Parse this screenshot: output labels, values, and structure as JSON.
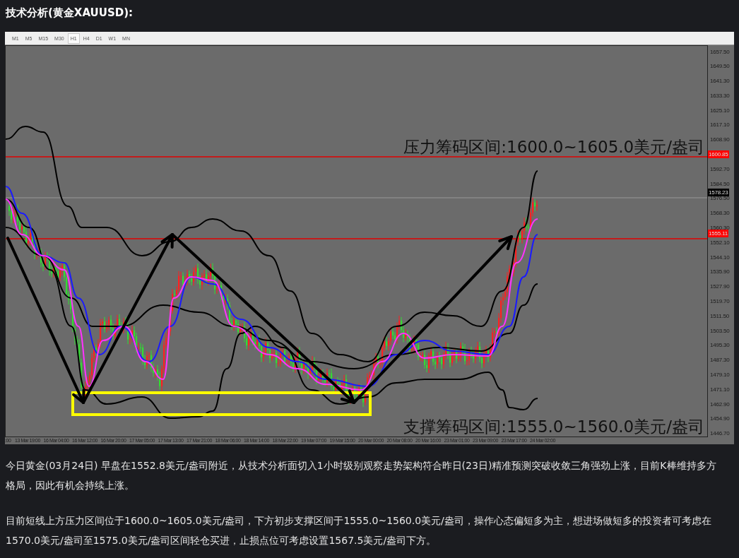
{
  "title": "技术分析(黄金XAUUSD):",
  "chart": {
    "timeframes": [
      {
        "label": "M1",
        "selected": false
      },
      {
        "label": "M5",
        "selected": false
      },
      {
        "label": "M15",
        "selected": false
      },
      {
        "label": "M30",
        "selected": false
      },
      {
        "label": "H1",
        "selected": true
      },
      {
        "label": "H4",
        "selected": false
      },
      {
        "label": "D1",
        "selected": false
      },
      {
        "label": "W1",
        "selected": false
      },
      {
        "label": "MN",
        "selected": false
      }
    ],
    "price_axis": [
      {
        "kind": "tick",
        "label": "1657.50"
      },
      {
        "kind": "tick",
        "label": "1649.50"
      },
      {
        "kind": "tick",
        "label": "1641.30"
      },
      {
        "kind": "tick",
        "label": "1633.30"
      },
      {
        "kind": "tick",
        "label": "1625.10"
      },
      {
        "kind": "tick",
        "label": "1617.10"
      },
      {
        "kind": "tick",
        "label": "1608.90"
      },
      {
        "kind": "level",
        "label": "1600.85"
      },
      {
        "kind": "tick",
        "label": "1592.70"
      },
      {
        "kind": "tick",
        "label": "1584.50"
      },
      {
        "kind": "tick",
        "label": "1576.50"
      },
      {
        "kind": "tick",
        "label": "1568.30"
      },
      {
        "kind": "tick",
        "label": "1560.30"
      },
      {
        "kind": "tick",
        "label": "1552.10"
      },
      {
        "kind": "tick",
        "label": "1544.10"
      },
      {
        "kind": "tick",
        "label": "1535.90"
      },
      {
        "kind": "tick",
        "label": "1527.90"
      },
      {
        "kind": "tick",
        "label": "1519.70"
      },
      {
        "kind": "tick",
        "label": "1511.50"
      },
      {
        "kind": "tick",
        "label": "1503.50"
      },
      {
        "kind": "tick",
        "label": "1495.30"
      },
      {
        "kind": "tick",
        "label": "1487.30"
      },
      {
        "kind": "tick",
        "label": "1479.10"
      },
      {
        "kind": "tick",
        "label": "1471.10"
      },
      {
        "kind": "tick",
        "label": "1462.90"
      },
      {
        "kind": "tick",
        "label": "1454.90"
      },
      {
        "kind": "tick",
        "label": "1446.70"
      }
    ],
    "price_markers": [
      {
        "kind": "current",
        "label": "1578.23"
      },
      {
        "kind": "support",
        "label": "1555.11"
      }
    ],
    "time_axis": [
      ":00",
      "13 Mar 19:00",
      "16 Mar 04:00",
      "16 Mar 12:00",
      "16 Mar 20:00",
      "17 Mar 05:00",
      "17 Mar 13:00",
      "17 Mar 21:00",
      "18 Mar 06:00",
      "18 Mar 14:00",
      "18 Mar 22:00",
      "19 Mar 07:00",
      "19 Mar 15:00",
      "20 Mar 00:00",
      "20 Mar 08:00",
      "20 Mar 16:00",
      "23 Mar 01:00",
      "23 Mar 09:00",
      "23 Mar 17:00",
      "24 Mar 02:00"
    ],
    "annotations": [
      {
        "kind": "resistance",
        "text": "压力筹码区间:1600.0~1605.0美元/盎司"
      },
      {
        "kind": "support",
        "text": "支撑筹码区间:1555.0~1560.0美元/盎司"
      }
    ]
  },
  "paragraphs": [
    "今日黄金(03月24日) 早盘在1552.8美元/盎司附近，从技术分析面切入1小时级别观察走势架构符合昨日(23日)精准预测突破收敛三角强劲上涨，目前K棒维持多方格局，因此有机会持续上涨。",
    "目前短线上方压力区间位于1600.0~1605.0美元/盎司，下方初步支撑区间于1555.0~1560.0美元/盎司，操作心态偏短多为主，想进场做短多的投资者可考虑在1570.0美元/盎司至1575.0美元/盎司区间轻仓买进，止损点位可考虑设置1567.5美元/盎司下方。"
  ]
}
